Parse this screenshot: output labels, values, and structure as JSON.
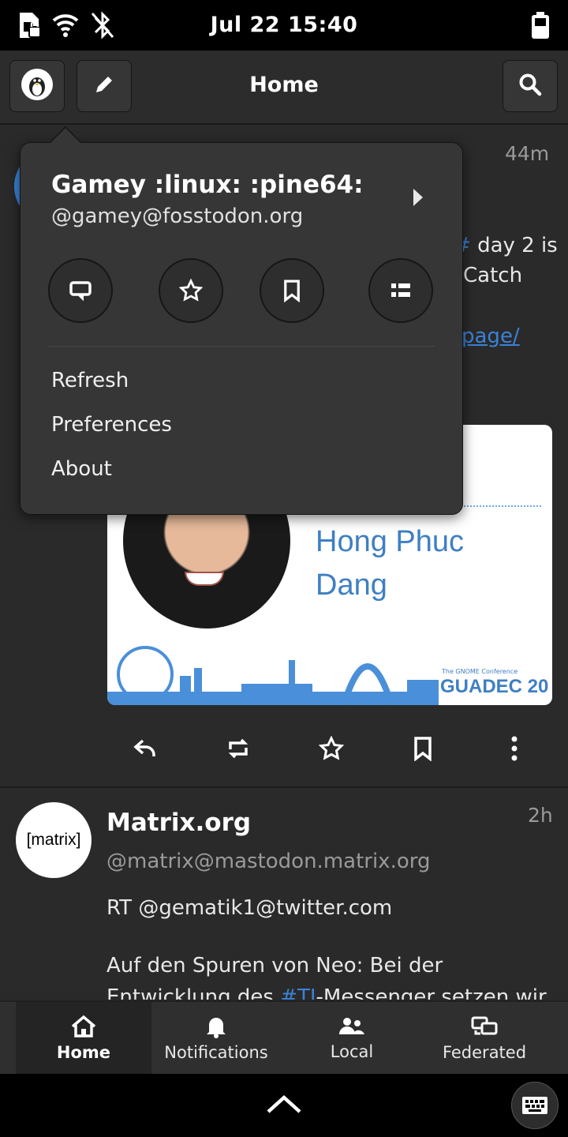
{
  "status_bar": {
    "time": "Jul 22  15:40"
  },
  "header": {
    "title": "Home"
  },
  "post1": {
    "time": "44m",
    "text_fragments": [
      "day 2 is",
      "Catch"
    ],
    "link_fragment": "page/",
    "card": {
      "name_line1": "Hong Phuc",
      "name_line2": "Dang",
      "badge_small": "The GNOME Conference",
      "badge": "GUADEC 20"
    }
  },
  "post2": {
    "time": "2h",
    "author": "Matrix.org",
    "handle": "@matrix@mastodon.matrix.org",
    "avatar_text": "[matrix]",
    "line1": "RT @gematik1@twitter.com",
    "line2": "Auf den Spuren von Neo: Bei der",
    "line3_pre": "Entwicklung des ",
    "line3_tag": "#TI",
    "line3_post": "-Messenger setzen wir"
  },
  "popover": {
    "name": "Gamey :linux: :pine64:",
    "handle": "@gamey@fosstodon.org",
    "menu": [
      "Refresh",
      "Preferences",
      "About"
    ]
  },
  "bottom_nav": {
    "tabs": [
      {
        "label": "Home",
        "icon": "home-icon"
      },
      {
        "label": "Notifications",
        "icon": "bell-icon"
      },
      {
        "label": "Local",
        "icon": "people-icon"
      },
      {
        "label": "Federated",
        "icon": "network-icon"
      }
    ]
  },
  "colors": {
    "accent": "#3b82d6",
    "background": "#242424",
    "popover": "#363636"
  }
}
